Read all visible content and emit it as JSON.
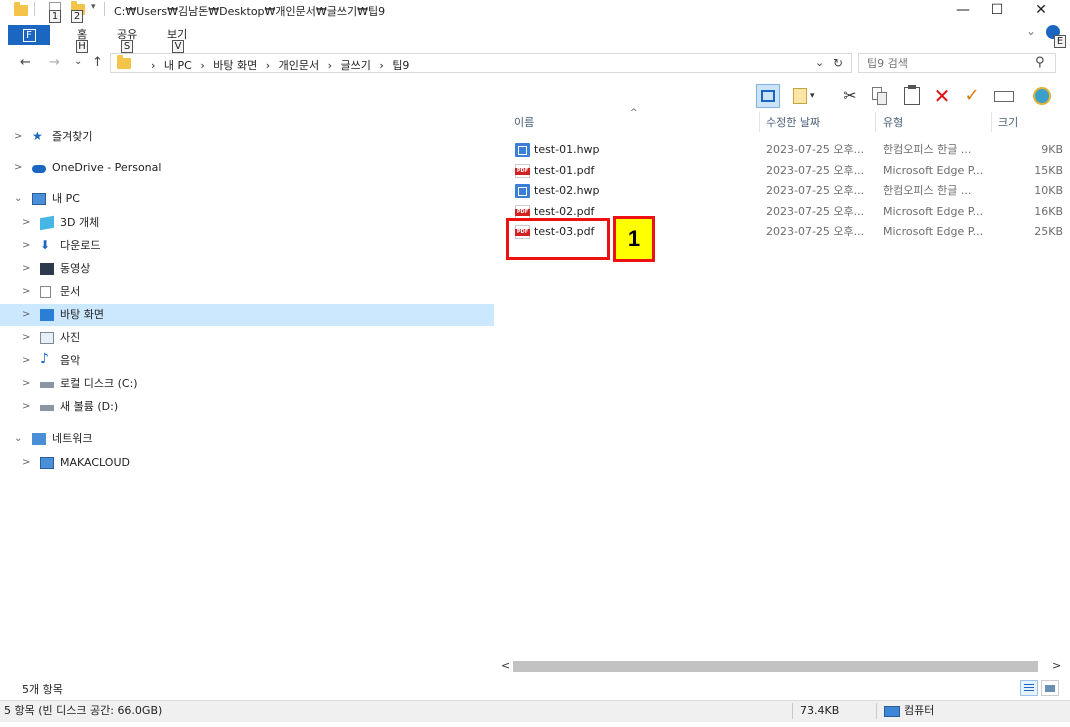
{
  "title_bar": {
    "path": "C:₩Users₩김남돈₩Desktop₩개인문서₩글쓰기₩팁9",
    "keytip_1": "1",
    "keytip_2": "2",
    "minimize": "—",
    "maximize": "☐",
    "close": "✕"
  },
  "ribbon": {
    "file_tab": "F",
    "tabs": [
      {
        "label": "홈",
        "keytip": "H"
      },
      {
        "label": "공유",
        "keytip": "S"
      },
      {
        "label": "보기",
        "keytip": "V"
      }
    ],
    "expand": "⌄",
    "help_keytip": "E"
  },
  "address": {
    "back": "←",
    "forward": "→",
    "recent": "⌄",
    "up": "↑",
    "breadcrumbs": [
      "›",
      "내 PC",
      "›",
      "바탕 화면",
      "›",
      "개인문서",
      "›",
      "글쓰기",
      "›",
      "팁9"
    ],
    "dropdown": "⌄",
    "refresh": "↻"
  },
  "search": {
    "placeholder": "팁9 검색",
    "icon": "⚲"
  },
  "toolbar_icons": [
    "details-pane-icon",
    "new-folder-icon",
    "cut-icon",
    "copy-icon",
    "paste-icon",
    "delete-icon",
    "checkmark-icon",
    "rename-icon",
    "properties-icon"
  ],
  "nav_pane": {
    "items": [
      {
        "label": "즐겨찾기",
        "icon": "star-icon",
        "chev": ">",
        "selected": false
      },
      {
        "label": "OneDrive - Personal",
        "icon": "cloud-icon",
        "chev": ">",
        "selected": false
      },
      {
        "label": "내 PC",
        "icon": "pc-icon",
        "chev": "⌄",
        "selected": false
      },
      {
        "label": "3D 개체",
        "icon": "3d-objects-icon",
        "chev": ">",
        "selected": false
      },
      {
        "label": "다운로드",
        "icon": "download-icon",
        "chev": ">",
        "selected": false
      },
      {
        "label": "동영상",
        "icon": "video-icon",
        "chev": ">",
        "selected": false
      },
      {
        "label": "문서",
        "icon": "document-icon",
        "chev": ">",
        "selected": false
      },
      {
        "label": "바탕 화면",
        "icon": "desktop-icon",
        "chev": ">",
        "selected": true
      },
      {
        "label": "사진",
        "icon": "pictures-icon",
        "chev": ">",
        "selected": false
      },
      {
        "label": "음악",
        "icon": "music-icon",
        "chev": ">",
        "selected": false
      },
      {
        "label": "로컬 디스크 (C:)",
        "icon": "disk-icon",
        "chev": ">",
        "selected": false
      },
      {
        "label": "새 볼륨 (D:)",
        "icon": "disk-icon",
        "chev": ">",
        "selected": false
      },
      {
        "label": "네트워크",
        "icon": "network-icon",
        "chev": "⌄",
        "selected": false
      },
      {
        "label": "MAKACLOUD",
        "icon": "pc-icon",
        "chev": ">",
        "selected": false
      }
    ]
  },
  "file_list": {
    "columns": [
      "이름",
      "수정한 날짜",
      "유형",
      "크기"
    ],
    "sort_indicator": "^",
    "files": [
      {
        "name": "test-01.hwp",
        "date": "2023-07-25 오후...",
        "type": "한컴오피스 한글 ...",
        "size": "9KB",
        "kind": "hwp"
      },
      {
        "name": "test-01.pdf",
        "date": "2023-07-25 오후...",
        "type": "Microsoft Edge P...",
        "size": "15KB",
        "kind": "pdf"
      },
      {
        "name": "test-02.hwp",
        "date": "2023-07-25 오후...",
        "type": "한컴오피스 한글 ...",
        "size": "10KB",
        "kind": "hwp"
      },
      {
        "name": "test-02.pdf",
        "date": "2023-07-25 오후...",
        "type": "Microsoft Edge P...",
        "size": "16KB",
        "kind": "pdf"
      },
      {
        "name": "test-03.pdf",
        "date": "2023-07-25 오후...",
        "type": "Microsoft Edge P...",
        "size": "25KB",
        "kind": "pdf"
      }
    ]
  },
  "annotation": {
    "badge": "1",
    "color": "#ee1111",
    "badge_bg": "#ffff00"
  },
  "scrollbar": {
    "left_arrow": "<",
    "right_arrow": ">"
  },
  "footer": {
    "item_count": "5개 항목"
  },
  "status_bar": {
    "left": "5 항목 (빈 디스크 공간: 66.0GB)",
    "size": "73.4KB",
    "location": "컴퓨터"
  },
  "colors": {
    "accent": "#1a66c0",
    "selection": "#cce8ff"
  }
}
